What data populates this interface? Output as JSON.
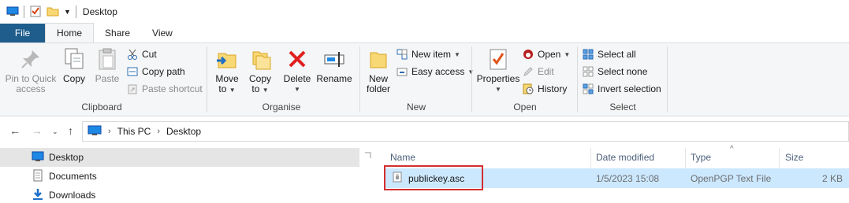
{
  "window": {
    "title": "Desktop"
  },
  "tabs": [
    "File",
    "Home",
    "Share",
    "View"
  ],
  "ribbon": {
    "clipboard": {
      "label": "Clipboard",
      "pin": "Pin to Quick\naccess",
      "pin_l1": "Pin to Quick",
      "pin_l2": "access",
      "copy": "Copy",
      "paste": "Paste",
      "cut": "Cut",
      "copy_path": "Copy path",
      "paste_shortcut": "Paste shortcut"
    },
    "organise": {
      "label": "Organise",
      "move_l1": "Move",
      "move_l2": "to",
      "copy_l1": "Copy",
      "copy_l2": "to",
      "delete": "Delete",
      "rename": "Rename"
    },
    "new": {
      "label": "New",
      "folder_l1": "New",
      "folder_l2": "folder",
      "new_item": "New item",
      "easy_access": "Easy access"
    },
    "open": {
      "label": "Open",
      "properties": "Properties",
      "open": "Open",
      "edit": "Edit",
      "history": "History"
    },
    "select": {
      "label": "Select",
      "select_all": "Select all",
      "select_none": "Select none",
      "invert": "Invert selection"
    }
  },
  "address": {
    "crumbs": [
      "This PC",
      "Desktop"
    ]
  },
  "nav_pane": {
    "items": [
      "Desktop",
      "Documents",
      "Downloads"
    ]
  },
  "file_list": {
    "columns": [
      "Name",
      "Date modified",
      "Type",
      "Size"
    ],
    "rows": [
      {
        "name": "publickey.asc",
        "date": "1/5/2023 15:08",
        "type": "OpenPGP Text File",
        "size": "2 KB"
      }
    ]
  },
  "colors": {
    "file_tab": "#1e5d8c",
    "selection": "#cce8ff",
    "highlight_box": "#d32f2f",
    "header_text": "#4c607a"
  }
}
